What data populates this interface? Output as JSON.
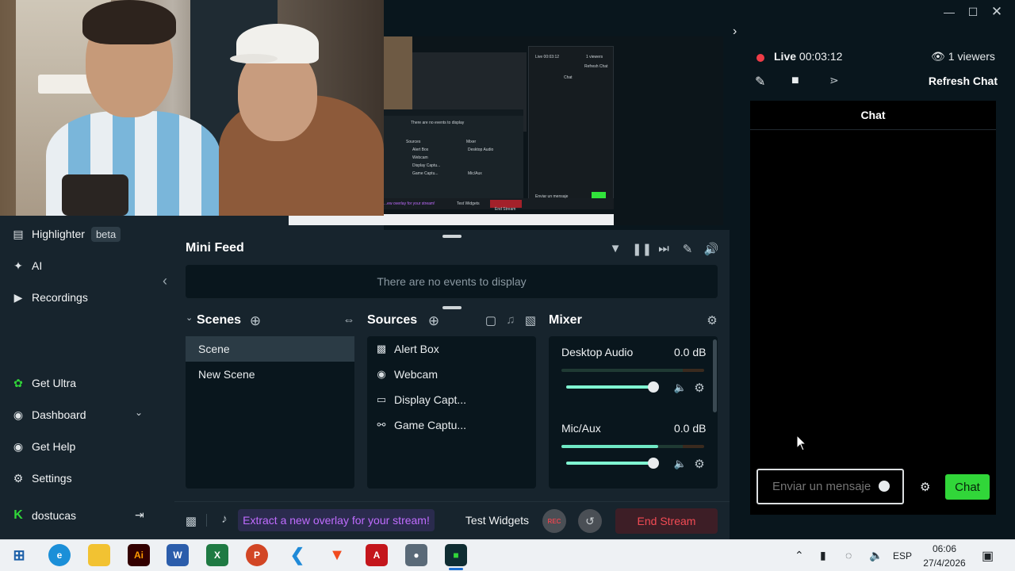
{
  "window": {
    "controls": [
      "minimize",
      "maximize",
      "close"
    ]
  },
  "preview": {
    "mini_texts": {
      "live": "Live 00:03:12",
      "viewers": "1 viewers",
      "refresh": "Refresh Chat",
      "chat": "Chat",
      "no_events": "There are no events to display",
      "sources": "Sources",
      "mixer": "Mixer",
      "desktop_audio": "Desktop Audio",
      "mic_aux": "Mic/Aux",
      "alert_box": "Alert Box",
      "webcam": "Webcam",
      "display_capt": "Display Captu...",
      "game_capt": "Game Captu...",
      "test_widgets": "Test Widgets",
      "end_stream": "End Stream",
      "input_placeholder": "Enviar un mensaje",
      "chat_btn": "Chat",
      "extract": "...ew overlay for your stream!"
    }
  },
  "sidebar": {
    "items_top": [
      {
        "label": "Highlighter",
        "icon": "highlighter-icon",
        "badge": "beta"
      },
      {
        "label": "AI",
        "icon": "sparkle-icon"
      },
      {
        "label": "Recordings",
        "icon": "play-circle-icon"
      }
    ],
    "items_bottom": [
      {
        "label": "Get Ultra",
        "icon": "ultra-icon"
      },
      {
        "label": "Dashboard",
        "icon": "dashboard-icon"
      },
      {
        "label": "Get Help",
        "icon": "help-icon"
      },
      {
        "label": "Settings",
        "icon": "gear-icon"
      }
    ],
    "user": {
      "name": "dostucas",
      "logo_letter": "K"
    }
  },
  "mini_feed": {
    "title": "Mini Feed",
    "empty_text": "There are no events to display"
  },
  "scenes": {
    "title": "Scenes",
    "items": [
      "Scene",
      "New Scene"
    ],
    "selected": "Scene"
  },
  "sources": {
    "title": "Sources",
    "items": [
      {
        "label": "Alert Box",
        "icon": "alert-box-icon"
      },
      {
        "label": "Webcam",
        "icon": "webcam-icon"
      },
      {
        "label": "Display Capt...",
        "icon": "monitor-icon"
      },
      {
        "label": "Game Captu...",
        "icon": "gamepad-icon"
      }
    ]
  },
  "mixer": {
    "title": "Mixer",
    "channels": [
      {
        "label": "Desktop Audio",
        "db": "0.0 dB",
        "level": 0,
        "volume": 0.95
      },
      {
        "label": "Mic/Aux",
        "db": "0.0 dB",
        "level": 0.68,
        "volume": 0.95
      }
    ]
  },
  "footer": {
    "extract": "Extract a new overlay for your stream!",
    "test_widgets": "Test Widgets",
    "rec": "REC",
    "end_stream": "End Stream"
  },
  "live_panel": {
    "status": "Live",
    "time": "00:03:12",
    "viewers": "1 viewers",
    "refresh": "Refresh Chat",
    "chat_title": "Chat",
    "input_placeholder": "Enviar un mensaje",
    "send": "Chat"
  },
  "taskbar": {
    "apps": [
      "Start",
      "Edge",
      "File Explorer",
      "Illustrator",
      "Word",
      "Excel",
      "PowerPoint",
      "VS Code",
      "Brave",
      "Acrobat",
      "Camera",
      "Streamlabs"
    ],
    "language": "ESP",
    "time": "06:06",
    "date": "27/4/2026"
  },
  "colors": {
    "accent_green": "#31d639",
    "live_red": "#ef3c47",
    "end_stream_red": "#f24b54",
    "extract_purple": "#c06cff",
    "mixer_teal": "#80f5d2"
  }
}
